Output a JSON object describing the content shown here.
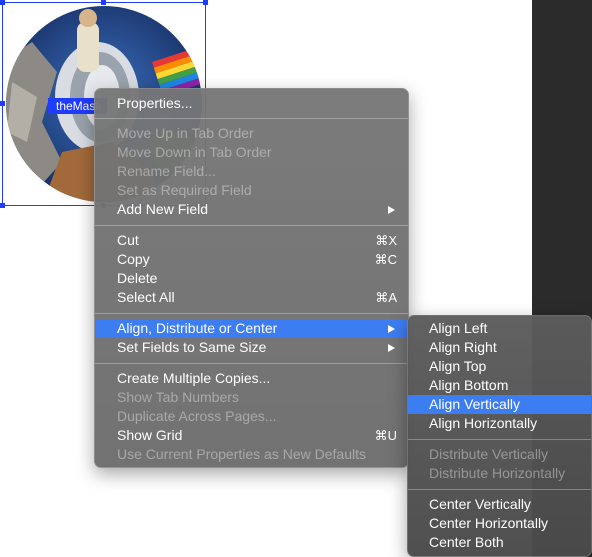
{
  "canvas": {
    "field_label": "theMask"
  },
  "context_menu": {
    "items": [
      {
        "label": "Properties...",
        "shortcut": "",
        "submenu": false,
        "disabled": false
      },
      {
        "label": "Move Up in Tab Order",
        "shortcut": "",
        "submenu": false,
        "disabled": true
      },
      {
        "label": "Move Down in Tab Order",
        "shortcut": "",
        "submenu": false,
        "disabled": true
      },
      {
        "label": "Rename Field...",
        "shortcut": "",
        "submenu": false,
        "disabled": true
      },
      {
        "label": "Set as Required Field",
        "shortcut": "",
        "submenu": false,
        "disabled": true
      },
      {
        "label": "Add New Field",
        "shortcut": "",
        "submenu": true,
        "disabled": false
      },
      {
        "label": "Cut",
        "shortcut": "⌘X",
        "submenu": false,
        "disabled": false
      },
      {
        "label": "Copy",
        "shortcut": "⌘C",
        "submenu": false,
        "disabled": false
      },
      {
        "label": "Delete",
        "shortcut": "",
        "submenu": false,
        "disabled": false
      },
      {
        "label": "Select All",
        "shortcut": "⌘A",
        "submenu": false,
        "disabled": false
      },
      {
        "label": "Align, Distribute or Center",
        "shortcut": "",
        "submenu": true,
        "disabled": false,
        "highlighted": true
      },
      {
        "label": "Set Fields to Same Size",
        "shortcut": "",
        "submenu": true,
        "disabled": false
      },
      {
        "label": "Create Multiple Copies...",
        "shortcut": "",
        "submenu": false,
        "disabled": false
      },
      {
        "label": "Show Tab Numbers",
        "shortcut": "",
        "submenu": false,
        "disabled": true
      },
      {
        "label": "Duplicate Across Pages...",
        "shortcut": "",
        "submenu": false,
        "disabled": true
      },
      {
        "label": "Show Grid",
        "shortcut": "⌘U",
        "submenu": false,
        "disabled": false
      },
      {
        "label": "Use Current Properties as New Defaults",
        "shortcut": "",
        "submenu": false,
        "disabled": true
      }
    ]
  },
  "submenu": {
    "items": [
      {
        "label": "Align Left",
        "disabled": false
      },
      {
        "label": "Align Right",
        "disabled": false
      },
      {
        "label": "Align Top",
        "disabled": false
      },
      {
        "label": "Align Bottom",
        "disabled": false
      },
      {
        "label": "Align Vertically",
        "disabled": false,
        "highlighted": true
      },
      {
        "label": "Align Horizontally",
        "disabled": false
      },
      {
        "label": "Distribute Vertically",
        "disabled": true
      },
      {
        "label": "Distribute Horizontally",
        "disabled": true
      },
      {
        "label": "Center Vertically",
        "disabled": false
      },
      {
        "label": "Center Horizontally",
        "disabled": false
      },
      {
        "label": "Center Both",
        "disabled": false
      }
    ]
  },
  "colors": {
    "highlight": "#3d7df2",
    "selection": "#1f3cff"
  }
}
